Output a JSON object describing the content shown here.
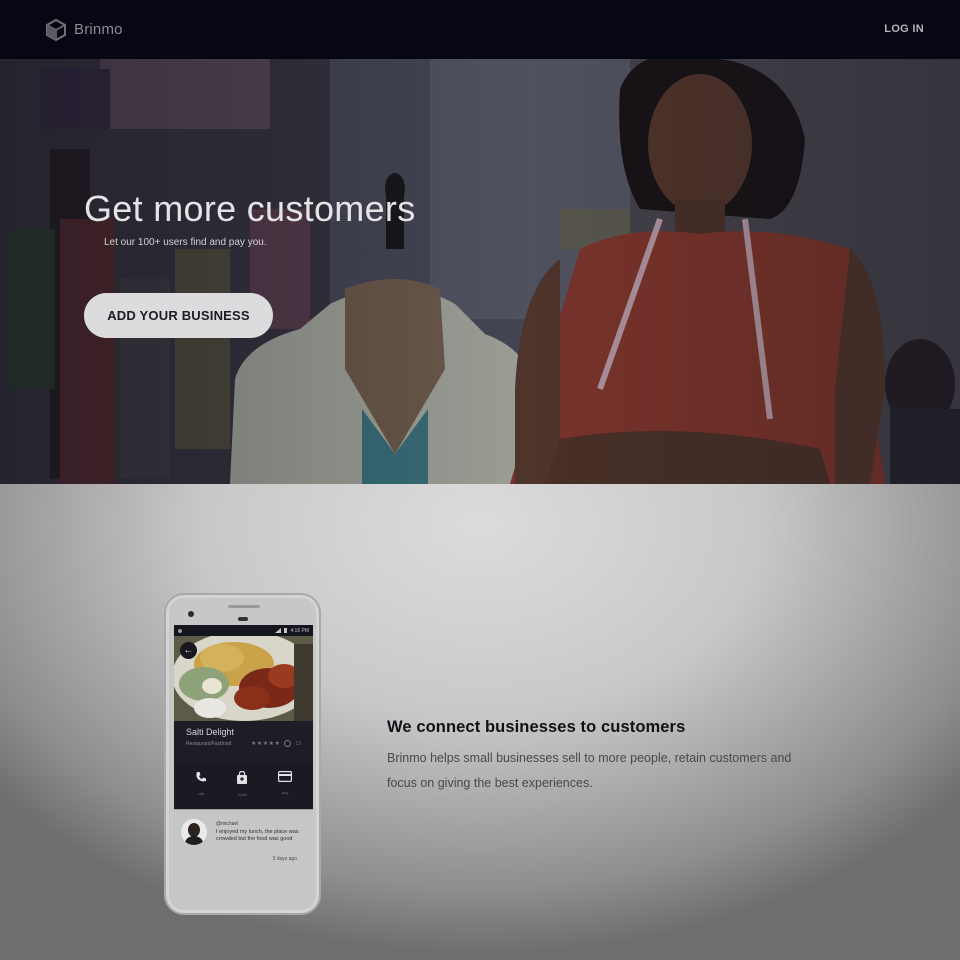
{
  "nav": {
    "brand": "Brinmo",
    "brand_icon": "cube-logo-icon",
    "login": "LOG IN"
  },
  "hero": {
    "title": "Get more customers",
    "subtitle": "Let our 100+ users find and pay you.",
    "cta": "ADD YOUR BUSINESS"
  },
  "feature": {
    "title": "We connect businesses to customers",
    "text": "Brinmo helps small businesses sell to more people, retain customers and focus on giving the best experiences."
  },
  "phone": {
    "status_time": "4:16 PM",
    "business_name": "Salti Delight",
    "business_category": "Restaurant/Fastfood",
    "rating_stars": "★★★★★",
    "rating_count": "13",
    "actions": [
      {
        "icon": "phone-icon",
        "label": "call"
      },
      {
        "icon": "shopping-bag-icon",
        "label": "order"
      },
      {
        "icon": "credit-card-icon",
        "label": "pay"
      }
    ],
    "review": {
      "user": "@michael",
      "text": "I enjoyed my lunch, the place was crowded but the food was good",
      "time": "3 days ago"
    }
  },
  "colors": {
    "nav_bg": "#070714",
    "cta_bg": "#dcdcde",
    "phone_screen": "#1d1d26"
  }
}
